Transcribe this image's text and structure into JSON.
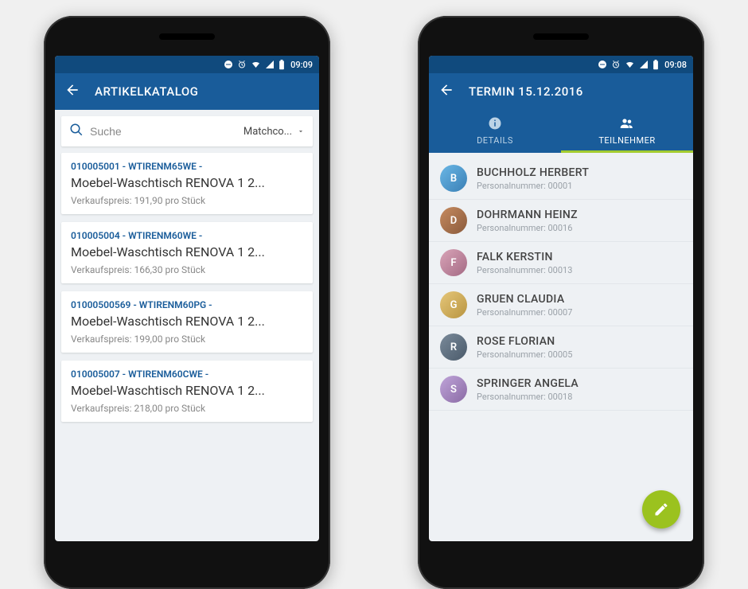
{
  "colors": {
    "primary": "#195c9a",
    "primaryDark": "#104a7d",
    "accent": "#9bc21f"
  },
  "left": {
    "status": {
      "time": "09:09"
    },
    "appbar": {
      "title": "ARTIKELKATALOG"
    },
    "search": {
      "placeholder": "Suche",
      "filterLabel": "Matchco..."
    },
    "items": [
      {
        "code": "010005001 - WTIRENM65WE -",
        "title": "Moebel-Waschtisch RENOVA 1 2...",
        "price": "Verkaufspreis: 191,90 pro Stück"
      },
      {
        "code": "010005004 - WTIRENM60WE -",
        "title": "Moebel-Waschtisch RENOVA 1 2...",
        "price": "Verkaufspreis: 166,30 pro Stück"
      },
      {
        "code": "01000500569 - WTIRENM60PG -",
        "title": "Moebel-Waschtisch RENOVA 1 2...",
        "price": "Verkaufspreis: 199,00 pro Stück"
      },
      {
        "code": "010005007 - WTIRENM60CWE -",
        "title": "Moebel-Waschtisch RENOVA 1 2...",
        "price": "Verkaufspreis: 218,00 pro Stück"
      }
    ]
  },
  "right": {
    "status": {
      "time": "09:08"
    },
    "appbar": {
      "title": "TERMIN 15.12.2016"
    },
    "tabs": {
      "details": "DETAILS",
      "participants": "TEILNEHMER"
    },
    "participants": [
      {
        "name": "BUCHHOLZ HERBERT",
        "num": "Personalnummer: 00001"
      },
      {
        "name": "DOHRMANN HEINZ",
        "num": "Personalnummer: 00016"
      },
      {
        "name": "FALK KERSTIN",
        "num": "Personalnummer: 00013"
      },
      {
        "name": "GRUEN CLAUDIA",
        "num": "Personalnummer: 00007"
      },
      {
        "name": "ROSE FLORIAN",
        "num": "Personalnummer: 00005"
      },
      {
        "name": "SPRINGER ANGELA",
        "num": "Personalnummer: 00018"
      }
    ]
  }
}
